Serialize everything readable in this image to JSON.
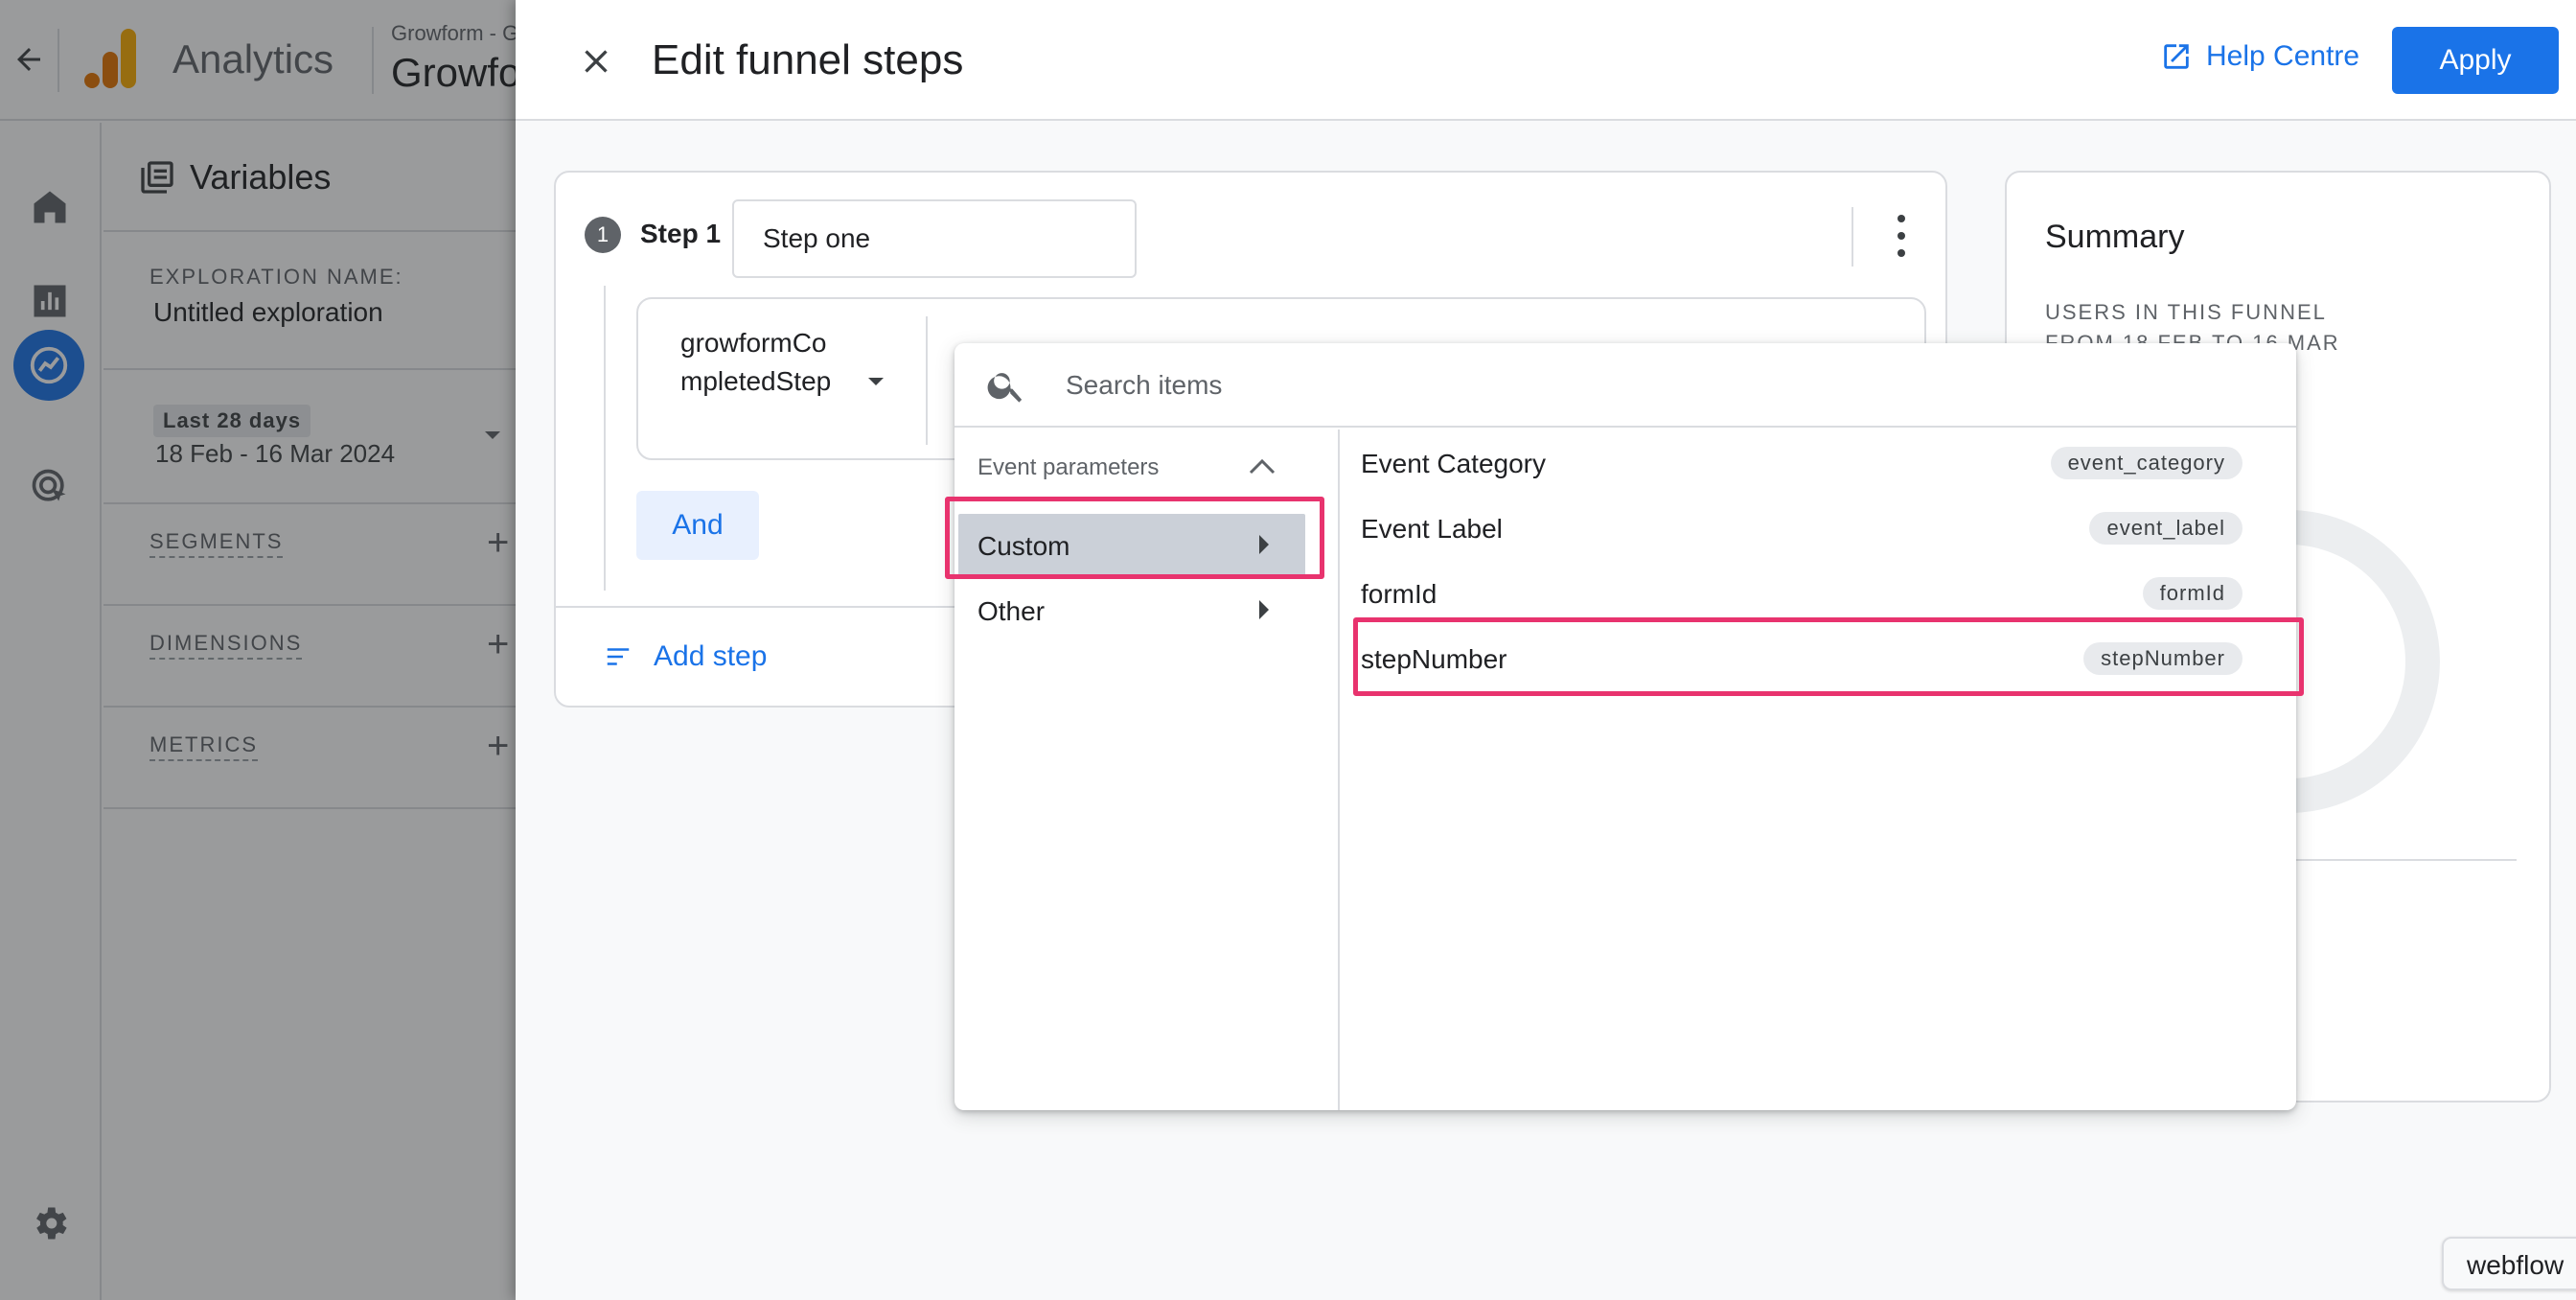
{
  "background": {
    "app_name": "Analytics",
    "property_small": "Growform - G",
    "property_big": "Growform",
    "variables": {
      "title": "Variables",
      "exploration_name_label": "EXPLORATION NAME:",
      "exploration_name": "Untitled exploration",
      "date_chip": "Last 28 days",
      "date_range": "18 Feb - 16 Mar 2024",
      "sections": [
        "SEGMENTS",
        "DIMENSIONS",
        "METRICS"
      ]
    }
  },
  "panel": {
    "title": "Edit funnel steps",
    "help_label": "Help Centre",
    "apply_label": "Apply",
    "step": {
      "number": "1",
      "label": "Step 1",
      "name_value": "Step one",
      "event_name": "growformCompletedStep",
      "and_label": "And",
      "add_step_label": "Add step"
    },
    "summary": {
      "title": "Summary",
      "subtitle_line1": "USERS IN THIS FUNNEL",
      "subtitle_line2": "FROM 18 FEB TO 16 MAR"
    }
  },
  "dropdown": {
    "search_placeholder": "Search items",
    "category_header": "Event parameters",
    "categories": [
      {
        "label": "Custom",
        "selected": true
      },
      {
        "label": "Other",
        "selected": false
      }
    ],
    "items": [
      {
        "name": "Event Category",
        "tag": "event_category"
      },
      {
        "name": "Event Label",
        "tag": "event_label"
      },
      {
        "name": "formId",
        "tag": "formId"
      },
      {
        "name": "stepNumber",
        "tag": "stepNumber"
      }
    ]
  },
  "badge": "webflow",
  "colors": {
    "accent": "#1a73e8",
    "highlight": "#e8336e",
    "logo_orange": "#f9ab00",
    "logo_dark_orange": "#e37400"
  }
}
